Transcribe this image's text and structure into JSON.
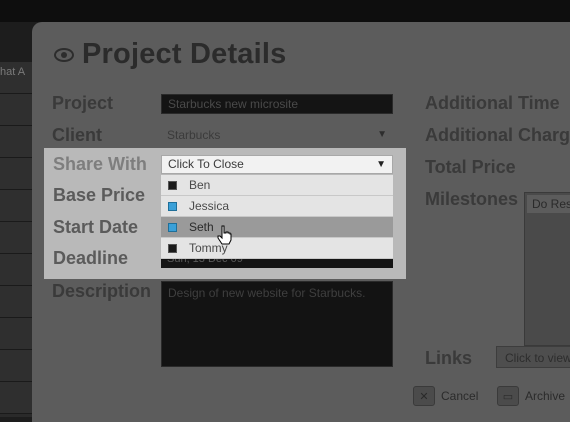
{
  "background": {
    "left_text": "hat A"
  },
  "modal": {
    "title": "Project Details",
    "labels": {
      "project": "Project",
      "client": "Client",
      "share_with": "Share With",
      "base_price": "Base Price",
      "start_date": "Start Date",
      "deadline": "Deadline",
      "description": "Description",
      "additional_time": "Additional Time",
      "additional_charge": "Additional Charg",
      "total_price": "Total Price",
      "milestones": "Milestones",
      "links": "Links"
    },
    "project_value": "Starbucks new microsite",
    "client_value": "Starbucks",
    "deadline_value": "Sun, 13 Dec 09",
    "description_value": "Design of new website for Starbucks.",
    "milestone_item": "Do Res",
    "links_button": "Click to view",
    "cancel_label": "Cancel",
    "archive_label": "Archive"
  },
  "share_dropdown": {
    "selected_label": "Click To Close",
    "options": [
      {
        "name": "Ben",
        "checked": false
      },
      {
        "name": "Jessica",
        "checked": true
      },
      {
        "name": "Seth",
        "checked": true,
        "hovered": true
      },
      {
        "name": "Tommy",
        "checked": false
      }
    ]
  },
  "icons": {
    "title": "eye-icon",
    "cancel": "close-icon",
    "archive": "folder-icon",
    "dropdown": "triangle-down-icon",
    "cursor": "hand-pointer-icon"
  },
  "colors": {
    "modal_bg": "#5c5c5c",
    "popup_bg": "#b9b9b9",
    "checked": "#3aa0d8",
    "unchecked": "#1a1a1a"
  }
}
